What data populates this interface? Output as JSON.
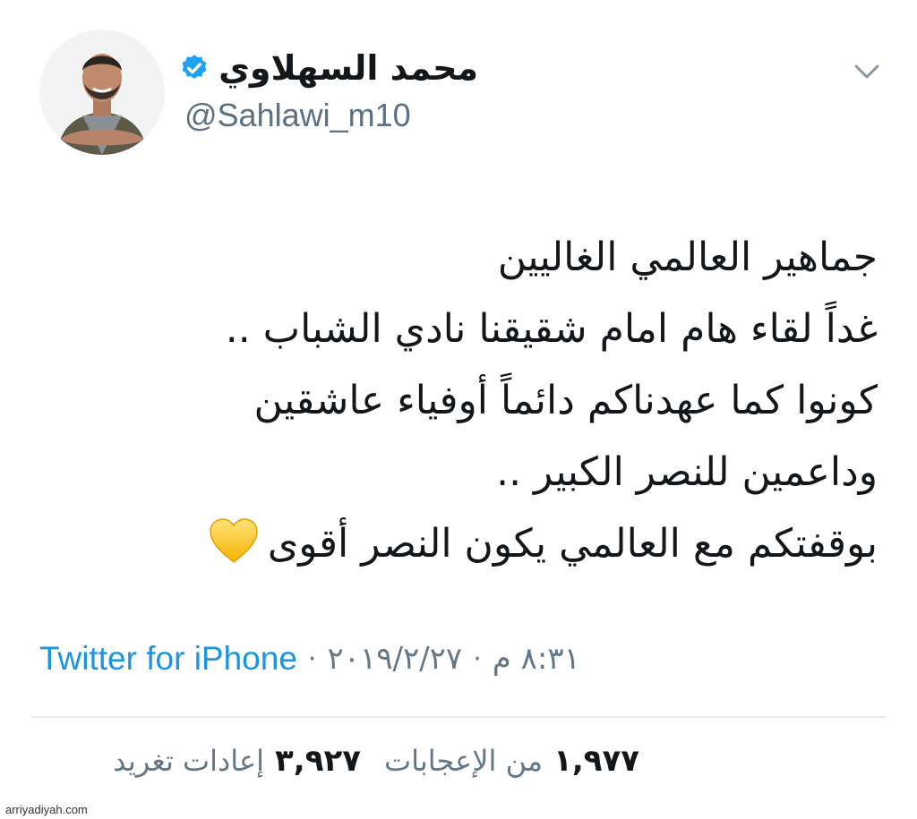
{
  "tweet": {
    "author": {
      "display_name": "محمد السهلاوي",
      "handle": "@Sahlawi_m10",
      "verified": true,
      "avatar_icon": "profile-photo"
    },
    "lines": [
      "جماهير العالمي الغاليين",
      "غداً لقاء هام امام شقيقنا نادي الشباب ..",
      "كونوا كما عهدناكم دائماً أوفياء عاشقين",
      "وداعمين للنصر الكبير ..",
      "بوقفتكم مع العالمي يكون النصر أقوى"
    ],
    "emoji": "yellow-heart",
    "time": "٨:٣١ م",
    "date": "٢٠١٩/٢/٢٧",
    "source": "Twitter for iPhone",
    "meta_separator": "·",
    "stats": {
      "retweets_count": "٣,٩٢٧",
      "retweets_label": "إعادات تغريد",
      "likes_count": "١,٩٧٧",
      "likes_label": "من الإعجابات"
    }
  },
  "watermark": "arriyadiyah.com",
  "colors": {
    "link": "#1b95e0",
    "verified": "#1da1f2",
    "secondary_text": "#657786",
    "heart": "#ffcc33"
  }
}
